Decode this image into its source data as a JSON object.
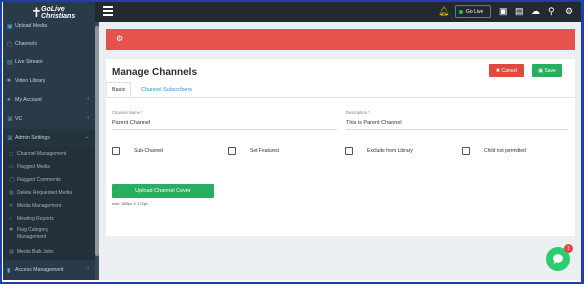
{
  "app": {
    "logo_line1": "GoLive",
    "logo_line2": "Christians"
  },
  "sidebar": {
    "items": [
      {
        "label": "Upload Media",
        "icon": "folder-icon"
      },
      {
        "label": "Channels",
        "icon": "channels-icon"
      },
      {
        "label": "Live Stream",
        "icon": "broadcast-icon"
      },
      {
        "label": "Video Library",
        "icon": "video-icon"
      },
      {
        "label": "My Account",
        "icon": "user-icon"
      },
      {
        "label": "VC",
        "icon": "vc-icon"
      },
      {
        "label": "Admin Settings",
        "icon": "settings-icon"
      }
    ],
    "subitems": [
      {
        "label": "Channel Management"
      },
      {
        "label": "Flagged Media"
      },
      {
        "label": "Flagged Comments"
      },
      {
        "label": "Delete Requested Media"
      },
      {
        "label": "Media Management"
      },
      {
        "label": "Meeting Reports"
      },
      {
        "label": "Flag Category Management"
      },
      {
        "label": "Media Bulk Jobs"
      }
    ],
    "bottom_item": {
      "label": "Access Management"
    }
  },
  "topbar": {
    "golive_label": "Go Live"
  },
  "card": {
    "title": "Manage Channels",
    "cancel_label": "Cancel",
    "save_label": "Save",
    "tabs": [
      {
        "label": "Basic"
      },
      {
        "label": "Channel Subscribers"
      }
    ],
    "channel_name": {
      "label": "Channel Name *",
      "value": "Parent Channel"
    },
    "description": {
      "label": "Description *",
      "value": "This is Parent Channel"
    },
    "checks": [
      {
        "label": "Sub-Channel",
        "checked": false
      },
      {
        "label": "Set Featured",
        "checked": false
      },
      {
        "label": "Exclude from Library",
        "checked": false
      },
      {
        "label": "Child not permitted",
        "checked": false
      }
    ],
    "upload_label": "Upload Channel Cover",
    "size_note": "size: 380px X 172px"
  },
  "chat": {
    "badge": "1"
  },
  "colors": {
    "accent_green": "#27ae60",
    "alert_red": "#e4544a",
    "sidebar_bg": "#293a48",
    "topbar_bg": "#222a31"
  }
}
